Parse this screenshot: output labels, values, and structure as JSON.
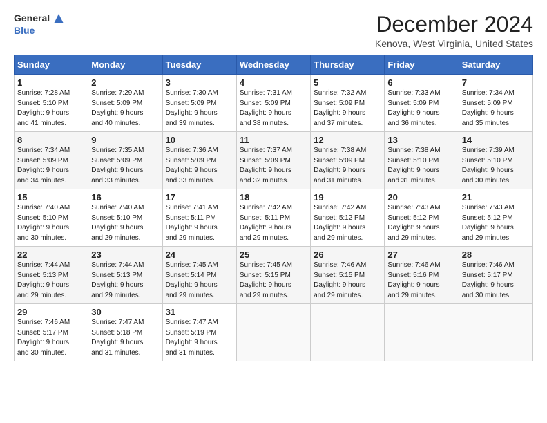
{
  "logo": {
    "line1": "General",
    "line2": "Blue"
  },
  "title": "December 2024",
  "subtitle": "Kenova, West Virginia, United States",
  "headers": [
    "Sunday",
    "Monday",
    "Tuesday",
    "Wednesday",
    "Thursday",
    "Friday",
    "Saturday"
  ],
  "weeks": [
    [
      {
        "day": "1",
        "sunrise": "7:28 AM",
        "sunset": "5:10 PM",
        "daylight": "9 hours and 41 minutes."
      },
      {
        "day": "2",
        "sunrise": "7:29 AM",
        "sunset": "5:09 PM",
        "daylight": "9 hours and 40 minutes."
      },
      {
        "day": "3",
        "sunrise": "7:30 AM",
        "sunset": "5:09 PM",
        "daylight": "9 hours and 39 minutes."
      },
      {
        "day": "4",
        "sunrise": "7:31 AM",
        "sunset": "5:09 PM",
        "daylight": "9 hours and 38 minutes."
      },
      {
        "day": "5",
        "sunrise": "7:32 AM",
        "sunset": "5:09 PM",
        "daylight": "9 hours and 37 minutes."
      },
      {
        "day": "6",
        "sunrise": "7:33 AM",
        "sunset": "5:09 PM",
        "daylight": "9 hours and 36 minutes."
      },
      {
        "day": "7",
        "sunrise": "7:34 AM",
        "sunset": "5:09 PM",
        "daylight": "9 hours and 35 minutes."
      }
    ],
    [
      {
        "day": "8",
        "sunrise": "7:34 AM",
        "sunset": "5:09 PM",
        "daylight": "9 hours and 34 minutes."
      },
      {
        "day": "9",
        "sunrise": "7:35 AM",
        "sunset": "5:09 PM",
        "daylight": "9 hours and 33 minutes."
      },
      {
        "day": "10",
        "sunrise": "7:36 AM",
        "sunset": "5:09 PM",
        "daylight": "9 hours and 33 minutes."
      },
      {
        "day": "11",
        "sunrise": "7:37 AM",
        "sunset": "5:09 PM",
        "daylight": "9 hours and 32 minutes."
      },
      {
        "day": "12",
        "sunrise": "7:38 AM",
        "sunset": "5:09 PM",
        "daylight": "9 hours and 31 minutes."
      },
      {
        "day": "13",
        "sunrise": "7:38 AM",
        "sunset": "5:10 PM",
        "daylight": "9 hours and 31 minutes."
      },
      {
        "day": "14",
        "sunrise": "7:39 AM",
        "sunset": "5:10 PM",
        "daylight": "9 hours and 30 minutes."
      }
    ],
    [
      {
        "day": "15",
        "sunrise": "7:40 AM",
        "sunset": "5:10 PM",
        "daylight": "9 hours and 30 minutes."
      },
      {
        "day": "16",
        "sunrise": "7:40 AM",
        "sunset": "5:10 PM",
        "daylight": "9 hours and 29 minutes."
      },
      {
        "day": "17",
        "sunrise": "7:41 AM",
        "sunset": "5:11 PM",
        "daylight": "9 hours and 29 minutes."
      },
      {
        "day": "18",
        "sunrise": "7:42 AM",
        "sunset": "5:11 PM",
        "daylight": "9 hours and 29 minutes."
      },
      {
        "day": "19",
        "sunrise": "7:42 AM",
        "sunset": "5:12 PM",
        "daylight": "9 hours and 29 minutes."
      },
      {
        "day": "20",
        "sunrise": "7:43 AM",
        "sunset": "5:12 PM",
        "daylight": "9 hours and 29 minutes."
      },
      {
        "day": "21",
        "sunrise": "7:43 AM",
        "sunset": "5:12 PM",
        "daylight": "9 hours and 29 minutes."
      }
    ],
    [
      {
        "day": "22",
        "sunrise": "7:44 AM",
        "sunset": "5:13 PM",
        "daylight": "9 hours and 29 minutes."
      },
      {
        "day": "23",
        "sunrise": "7:44 AM",
        "sunset": "5:13 PM",
        "daylight": "9 hours and 29 minutes."
      },
      {
        "day": "24",
        "sunrise": "7:45 AM",
        "sunset": "5:14 PM",
        "daylight": "9 hours and 29 minutes."
      },
      {
        "day": "25",
        "sunrise": "7:45 AM",
        "sunset": "5:15 PM",
        "daylight": "9 hours and 29 minutes."
      },
      {
        "day": "26",
        "sunrise": "7:46 AM",
        "sunset": "5:15 PM",
        "daylight": "9 hours and 29 minutes."
      },
      {
        "day": "27",
        "sunrise": "7:46 AM",
        "sunset": "5:16 PM",
        "daylight": "9 hours and 29 minutes."
      },
      {
        "day": "28",
        "sunrise": "7:46 AM",
        "sunset": "5:17 PM",
        "daylight": "9 hours and 30 minutes."
      }
    ],
    [
      {
        "day": "29",
        "sunrise": "7:46 AM",
        "sunset": "5:17 PM",
        "daylight": "9 hours and 30 minutes."
      },
      {
        "day": "30",
        "sunrise": "7:47 AM",
        "sunset": "5:18 PM",
        "daylight": "9 hours and 31 minutes."
      },
      {
        "day": "31",
        "sunrise": "7:47 AM",
        "sunset": "5:19 PM",
        "daylight": "9 hours and 31 minutes."
      },
      null,
      null,
      null,
      null
    ]
  ],
  "labels": {
    "sunrise": "Sunrise:",
    "sunset": "Sunset:",
    "daylight": "Daylight:"
  }
}
